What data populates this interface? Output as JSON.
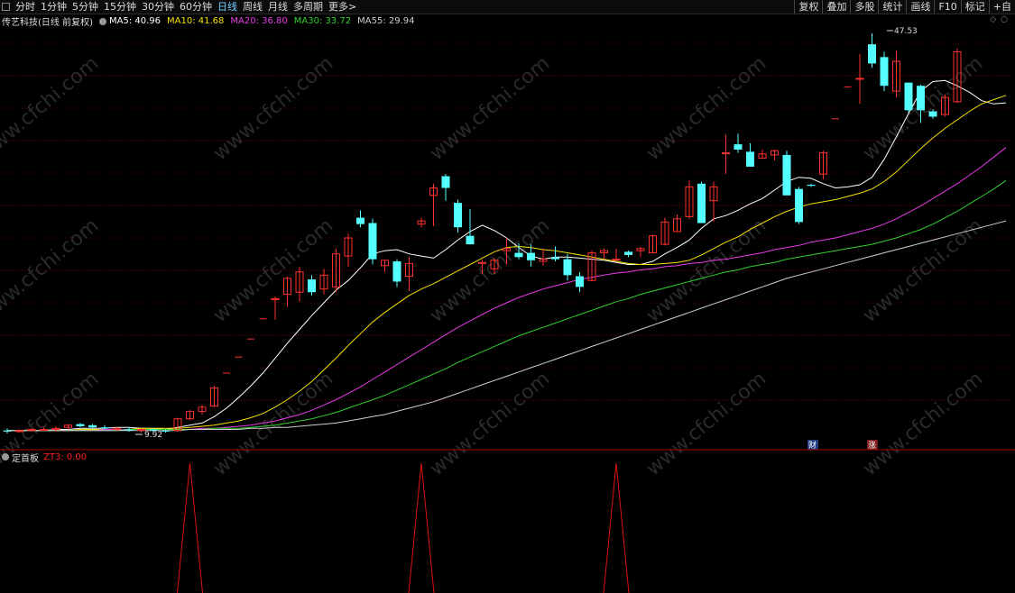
{
  "toolbar": {
    "periods": [
      "分时",
      "1分钟",
      "5分钟",
      "15分钟",
      "30分钟",
      "60分钟",
      "日线",
      "周线",
      "月线",
      "多周期",
      "更多>"
    ],
    "active_period": "日线",
    "tools": [
      "复权",
      "叠加",
      "多股",
      "统计",
      "画线",
      "F10",
      "标记",
      "+自"
    ]
  },
  "stock": {
    "title": "传艺科技(日线 前复权)"
  },
  "ma_legend": [
    {
      "label": "MA5: 40.96",
      "color": "#ffffff"
    },
    {
      "label": "MA10: 41.68",
      "color": "#f5e100"
    },
    {
      "label": "MA20: 36.80",
      "color": "#e83ae8"
    },
    {
      "label": "MA30: 33.72",
      "color": "#2fd02f"
    },
    {
      "label": "MA55: 29.94",
      "color": "#d0d0d0"
    }
  ],
  "chart_annotations": {
    "high_label": "47.53",
    "low_label": "9.92",
    "marker_cai": "财",
    "marker_zhang": "涨"
  },
  "indicator": {
    "name": "定首板",
    "value_label": "ZT3: 0.00",
    "color": "#ff2020"
  },
  "watermark": "www.cfchi.com",
  "colors": {
    "up": "#ff3030",
    "down": "#54ffff",
    "grid": "#6a0000",
    "background": "#000000"
  },
  "chart_data": {
    "type": "candlestick",
    "y_scale": {
      "min": 9.92,
      "max": 47.53
    },
    "candles": [
      {
        "open": 10.2,
        "high": 10.4,
        "low": 9.92,
        "close": 10.1,
        "dir": "down"
      },
      {
        "open": 10.1,
        "high": 10.3,
        "low": 10.0,
        "close": 10.2,
        "dir": "up"
      },
      {
        "open": 10.2,
        "high": 10.4,
        "low": 10.1,
        "close": 10.3,
        "dir": "up"
      },
      {
        "open": 10.3,
        "high": 10.5,
        "low": 10.2,
        "close": 10.3,
        "dir": "up"
      },
      {
        "open": 10.3,
        "high": 10.6,
        "low": 10.1,
        "close": 10.4,
        "dir": "up"
      },
      {
        "open": 10.5,
        "high": 10.8,
        "low": 10.3,
        "close": 10.7,
        "dir": "up"
      },
      {
        "open": 10.8,
        "high": 10.9,
        "low": 10.5,
        "close": 10.6,
        "dir": "down"
      },
      {
        "open": 10.7,
        "high": 10.8,
        "low": 10.4,
        "close": 10.5,
        "dir": "down"
      },
      {
        "open": 10.5,
        "high": 10.7,
        "low": 10.3,
        "close": 10.4,
        "dir": "down"
      },
      {
        "open": 10.4,
        "high": 10.5,
        "low": 10.2,
        "close": 10.3,
        "dir": "up"
      },
      {
        "open": 10.3,
        "high": 10.5,
        "low": 10.1,
        "close": 10.2,
        "dir": "down"
      },
      {
        "open": 10.2,
        "high": 10.4,
        "low": 10.0,
        "close": 10.3,
        "dir": "up"
      },
      {
        "open": 10.3,
        "high": 10.4,
        "low": 10.1,
        "close": 10.2,
        "dir": "down"
      },
      {
        "open": 10.2,
        "high": 10.3,
        "low": 10.0,
        "close": 10.1,
        "dir": "down"
      },
      {
        "open": 10.2,
        "high": 11.4,
        "low": 10.1,
        "close": 11.3,
        "dir": "up"
      },
      {
        "open": 11.3,
        "high": 12.1,
        "low": 11.2,
        "close": 12.0,
        "dir": "up"
      },
      {
        "open": 12.0,
        "high": 12.6,
        "low": 11.7,
        "close": 12.4,
        "dir": "up"
      },
      {
        "open": 12.5,
        "high": 14.4,
        "low": 12.4,
        "close": 14.2,
        "dir": "up"
      },
      {
        "open": 15.6,
        "high": 15.6,
        "low": 15.6,
        "close": 15.6,
        "dir": "up"
      },
      {
        "open": 17.1,
        "high": 17.1,
        "low": 17.1,
        "close": 17.1,
        "dir": "up"
      },
      {
        "open": 18.8,
        "high": 18.8,
        "low": 18.8,
        "close": 18.8,
        "dir": "up"
      },
      {
        "open": 20.7,
        "high": 20.7,
        "low": 20.7,
        "close": 20.7,
        "dir": "up"
      },
      {
        "open": 22.5,
        "high": 22.8,
        "low": 20.6,
        "close": 22.6,
        "dir": "up"
      },
      {
        "open": 23.0,
        "high": 24.7,
        "low": 21.8,
        "close": 24.5,
        "dir": "up"
      },
      {
        "open": 23.2,
        "high": 25.6,
        "low": 22.3,
        "close": 25.1,
        "dir": "up"
      },
      {
        "open": 24.4,
        "high": 24.8,
        "low": 22.9,
        "close": 23.2,
        "dir": "down"
      },
      {
        "open": 23.5,
        "high": 25.4,
        "low": 23.0,
        "close": 24.8,
        "dir": "up"
      },
      {
        "open": 23.7,
        "high": 27.3,
        "low": 23.2,
        "close": 26.8,
        "dir": "up"
      },
      {
        "open": 26.6,
        "high": 28.7,
        "low": 25.6,
        "close": 28.3,
        "dir": "up"
      },
      {
        "open": 30.2,
        "high": 30.9,
        "low": 29.3,
        "close": 29.6,
        "dir": "down"
      },
      {
        "open": 29.7,
        "high": 30.1,
        "low": 25.8,
        "close": 26.3,
        "dir": "down"
      },
      {
        "open": 26.2,
        "high": 26.3,
        "low": 25.1,
        "close": 25.7,
        "dir": "up"
      },
      {
        "open": 26.1,
        "high": 26.3,
        "low": 23.7,
        "close": 24.2,
        "dir": "down"
      },
      {
        "open": 24.7,
        "high": 26.5,
        "low": 23.3,
        "close": 25.9,
        "dir": "up"
      },
      {
        "open": 29.6,
        "high": 30.2,
        "low": 29.3,
        "close": 29.9,
        "dir": "up"
      },
      {
        "open": 32.3,
        "high": 33.4,
        "low": 29.4,
        "close": 33.0,
        "dir": "up"
      },
      {
        "open": 34.1,
        "high": 34.3,
        "low": 31.8,
        "close": 33.0,
        "dir": "down"
      },
      {
        "open": 31.6,
        "high": 31.9,
        "low": 28.8,
        "close": 29.3,
        "dir": "down"
      },
      {
        "open": 28.5,
        "high": 31.0,
        "low": 27.7,
        "close": 27.7,
        "dir": "down"
      },
      {
        "open": 25.9,
        "high": 26.2,
        "low": 24.9,
        "close": 26.0,
        "dir": "up"
      },
      {
        "open": 25.4,
        "high": 26.4,
        "low": 24.9,
        "close": 26.2,
        "dir": "up"
      },
      {
        "open": 27.1,
        "high": 28.3,
        "low": 25.8,
        "close": 27.3,
        "dir": "up"
      },
      {
        "open": 26.9,
        "high": 27.8,
        "low": 26.3,
        "close": 26.5,
        "dir": "down"
      },
      {
        "open": 26.9,
        "high": 27.7,
        "low": 25.6,
        "close": 26.2,
        "dir": "down"
      },
      {
        "open": 26.1,
        "high": 27.3,
        "low": 25.7,
        "close": 26.3,
        "dir": "up"
      },
      {
        "open": 26.3,
        "high": 27.5,
        "low": 26.1,
        "close": 26.5,
        "dir": "down"
      },
      {
        "open": 26.3,
        "high": 26.8,
        "low": 24.3,
        "close": 24.8,
        "dir": "down"
      },
      {
        "open": 24.7,
        "high": 25.1,
        "low": 23.2,
        "close": 23.7,
        "dir": "down"
      },
      {
        "open": 24.3,
        "high": 27.1,
        "low": 24.2,
        "close": 26.9,
        "dir": "up"
      },
      {
        "open": 27.1,
        "high": 27.3,
        "low": 26.3,
        "close": 26.9,
        "dir": "up"
      },
      {
        "open": 26.3,
        "high": 27.3,
        "low": 26.2,
        "close": 26.3,
        "dir": "up"
      },
      {
        "open": 27.0,
        "high": 27.1,
        "low": 26.5,
        "close": 26.7,
        "dir": "down"
      },
      {
        "open": 27.3,
        "high": 27.5,
        "low": 26.5,
        "close": 27.1,
        "dir": "up"
      },
      {
        "open": 26.9,
        "high": 28.6,
        "low": 26.9,
        "close": 28.5,
        "dir": "up"
      },
      {
        "open": 27.7,
        "high": 30.2,
        "low": 27.6,
        "close": 29.8,
        "dir": "up"
      },
      {
        "open": 28.9,
        "high": 30.5,
        "low": 28.9,
        "close": 30.1,
        "dir": "up"
      },
      {
        "open": 30.3,
        "high": 33.7,
        "low": 30.1,
        "close": 33.1,
        "dir": "up"
      },
      {
        "open": 33.4,
        "high": 33.6,
        "low": 29.8,
        "close": 29.7,
        "dir": "down"
      },
      {
        "open": 31.8,
        "high": 33.6,
        "low": 29.8,
        "close": 33.1,
        "dir": "up"
      },
      {
        "open": 36.3,
        "high": 38.0,
        "low": 34.3,
        "close": 36.3,
        "dir": "up"
      },
      {
        "open": 37.1,
        "high": 38.1,
        "low": 36.3,
        "close": 36.6,
        "dir": "down"
      },
      {
        "open": 36.4,
        "high": 37.2,
        "low": 35.1,
        "close": 35.0,
        "dir": "down"
      },
      {
        "open": 35.8,
        "high": 36.6,
        "low": 35.8,
        "close": 36.2,
        "dir": "up"
      },
      {
        "open": 36.5,
        "high": 36.6,
        "low": 35.6,
        "close": 36.1,
        "dir": "up"
      },
      {
        "open": 36.1,
        "high": 36.5,
        "low": 32.3,
        "close": 32.3,
        "dir": "down"
      },
      {
        "open": 32.9,
        "high": 33.1,
        "low": 29.6,
        "close": 29.8,
        "dir": "down"
      },
      {
        "open": 33.2,
        "high": 33.4,
        "low": 33.1,
        "close": 33.3,
        "dir": "down"
      },
      {
        "open": 34.3,
        "high": 36.5,
        "low": 33.8,
        "close": 36.3,
        "dir": "up"
      },
      {
        "open": 39.5,
        "high": 39.5,
        "low": 39.5,
        "close": 39.5,
        "dir": "up"
      },
      {
        "open": 42.5,
        "high": 42.5,
        "low": 42.5,
        "close": 42.5,
        "dir": "up"
      },
      {
        "open": 43.3,
        "high": 45.6,
        "low": 40.9,
        "close": 43.3,
        "dir": "up"
      },
      {
        "open": 46.5,
        "high": 47.53,
        "low": 44.3,
        "close": 44.7,
        "dir": "down"
      },
      {
        "open": 45.3,
        "high": 45.8,
        "low": 42.1,
        "close": 42.6,
        "dir": "down"
      },
      {
        "open": 44.9,
        "high": 45.9,
        "low": 41.5,
        "close": 42.1,
        "dir": "up"
      },
      {
        "open": 42.9,
        "high": 42.9,
        "low": 40.1,
        "close": 40.3,
        "dir": "down"
      },
      {
        "open": 42.6,
        "high": 42.7,
        "low": 39.1,
        "close": 40.3,
        "dir": "down"
      },
      {
        "open": 40.2,
        "high": 40.4,
        "low": 39.5,
        "close": 39.7,
        "dir": "down"
      },
      {
        "open": 39.9,
        "high": 41.8,
        "low": 39.7,
        "close": 41.5,
        "dir": "up"
      },
      {
        "open": 41.1,
        "high": 46.1,
        "low": 41.0,
        "close": 45.8,
        "dir": "up"
      }
    ],
    "ma_lines": [
      {
        "name": "MA5",
        "color": "#ffffff",
        "values": [
          10.2,
          10.2,
          10.2,
          10.2,
          10.3,
          10.3,
          10.4,
          10.4,
          10.4,
          10.5,
          10.5,
          10.4,
          10.4,
          10.3,
          10.5,
          10.7,
          10.9,
          11.5,
          12.3,
          13.3,
          14.4,
          15.6,
          17.0,
          18.4,
          19.7,
          21.0,
          22.2,
          23.4,
          24.3,
          25.5,
          26.8,
          27.1,
          27.2,
          26.8,
          26.6,
          26.4,
          27.2,
          28.1,
          28.9,
          29.5,
          29.0,
          28.3,
          27.4,
          26.6,
          26.3,
          26.5,
          26.5,
          26.4,
          26.3,
          26.2,
          26.0,
          25.8,
          25.8,
          26.1,
          26.8,
          27.4,
          28.1,
          29.2,
          30.1,
          30.4,
          30.9,
          31.5,
          32.0,
          32.8,
          33.6,
          34.0,
          33.9,
          33.4,
          33.0,
          33.1,
          33.3,
          34.0,
          35.7,
          37.8,
          40.0,
          42.1,
          43.0,
          43.1,
          42.6,
          42.0,
          41.2,
          40.9,
          41.0
        ]
      },
      {
        "name": "MA10",
        "color": "#f5e100",
        "values": [
          10.2,
          10.2,
          10.2,
          10.2,
          10.2,
          10.2,
          10.3,
          10.3,
          10.3,
          10.3,
          10.3,
          10.4,
          10.4,
          10.4,
          10.4,
          10.5,
          10.6,
          10.7,
          10.9,
          11.1,
          11.4,
          11.8,
          12.4,
          13.1,
          13.9,
          14.8,
          15.9,
          17.0,
          18.2,
          19.3,
          20.4,
          21.3,
          22.1,
          22.9,
          23.5,
          24.0,
          24.6,
          25.2,
          25.8,
          26.4,
          27.0,
          27.4,
          27.5,
          27.4,
          27.2,
          27.1,
          26.9,
          26.7,
          26.5,
          26.3,
          26.1,
          25.9,
          25.8,
          25.8,
          25.9,
          26.0,
          26.2,
          26.7,
          27.3,
          27.9,
          28.4,
          29.1,
          29.7,
          30.3,
          30.8,
          31.2,
          31.5,
          31.7,
          31.9,
          32.2,
          32.5,
          32.9,
          33.6,
          34.5,
          35.6,
          36.7,
          37.7,
          38.6,
          39.4,
          40.2,
          40.9,
          41.3,
          41.7
        ]
      },
      {
        "name": "MA20",
        "color": "#e83ae8",
        "values": [
          10.2,
          10.2,
          10.2,
          10.2,
          10.2,
          10.2,
          10.2,
          10.2,
          10.3,
          10.3,
          10.3,
          10.3,
          10.3,
          10.3,
          10.3,
          10.3,
          10.4,
          10.4,
          10.5,
          10.6,
          10.7,
          10.9,
          11.1,
          11.4,
          11.7,
          12.1,
          12.6,
          13.1,
          13.7,
          14.3,
          15.0,
          15.7,
          16.4,
          17.1,
          17.8,
          18.5,
          19.2,
          19.9,
          20.5,
          21.1,
          21.7,
          22.2,
          22.7,
          23.1,
          23.5,
          23.8,
          24.1,
          24.4,
          24.6,
          24.8,
          25.0,
          25.1,
          25.3,
          25.4,
          25.6,
          25.7,
          25.9,
          26.0,
          26.2,
          26.3,
          26.5,
          26.7,
          26.9,
          27.2,
          27.4,
          27.6,
          27.9,
          28.1,
          28.3,
          28.6,
          28.9,
          29.2,
          29.6,
          30.1,
          30.7,
          31.3,
          32.0,
          32.7,
          33.4,
          34.2,
          35.0,
          35.9,
          36.8
        ]
      },
      {
        "name": "MA30",
        "color": "#2fd02f",
        "values": [
          10.2,
          10.2,
          10.2,
          10.2,
          10.2,
          10.2,
          10.2,
          10.2,
          10.2,
          10.2,
          10.3,
          10.3,
          10.3,
          10.3,
          10.3,
          10.3,
          10.3,
          10.4,
          10.4,
          10.4,
          10.5,
          10.6,
          10.7,
          10.9,
          11.1,
          11.3,
          11.6,
          11.9,
          12.3,
          12.7,
          13.1,
          13.5,
          14.0,
          14.5,
          15.0,
          15.5,
          16.0,
          16.6,
          17.1,
          17.6,
          18.1,
          18.6,
          19.1,
          19.5,
          19.9,
          20.3,
          20.7,
          21.1,
          21.5,
          21.9,
          22.3,
          22.6,
          23.0,
          23.3,
          23.6,
          23.9,
          24.2,
          24.5,
          24.8,
          25.1,
          25.3,
          25.6,
          25.8,
          26.0,
          26.3,
          26.5,
          26.7,
          26.9,
          27.1,
          27.3,
          27.5,
          27.7,
          28.0,
          28.3,
          28.7,
          29.1,
          29.6,
          30.2,
          30.8,
          31.5,
          32.2,
          32.9,
          33.7
        ]
      },
      {
        "name": "MA55",
        "color": "#d0d0d0",
        "values": [
          10.2,
          10.2,
          10.2,
          10.2,
          10.2,
          10.2,
          10.2,
          10.2,
          10.2,
          10.2,
          10.2,
          10.2,
          10.2,
          10.2,
          10.2,
          10.3,
          10.3,
          10.3,
          10.3,
          10.3,
          10.4,
          10.4,
          10.5,
          10.5,
          10.6,
          10.7,
          10.8,
          10.9,
          11.1,
          11.3,
          11.5,
          11.7,
          12.0,
          12.3,
          12.6,
          12.9,
          13.3,
          13.7,
          14.1,
          14.5,
          14.9,
          15.3,
          15.7,
          16.1,
          16.5,
          16.9,
          17.3,
          17.7,
          18.1,
          18.5,
          18.9,
          19.3,
          19.7,
          20.1,
          20.5,
          20.9,
          21.3,
          21.7,
          22.1,
          22.5,
          22.9,
          23.3,
          23.7,
          24.1,
          24.5,
          24.8,
          25.1,
          25.4,
          25.7,
          26.0,
          26.3,
          26.6,
          26.9,
          27.2,
          27.5,
          27.8,
          28.1,
          28.4,
          28.7,
          29.0,
          29.3,
          29.6,
          29.9
        ]
      }
    ],
    "indicator_peaks": [
      15,
      34,
      50
    ]
  }
}
